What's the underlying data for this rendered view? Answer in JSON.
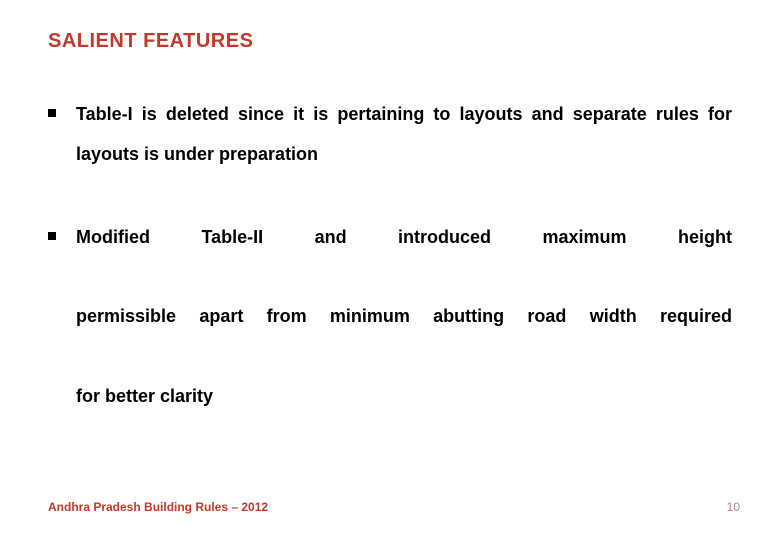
{
  "title": "SALIENT FEATURES",
  "bullets": [
    {
      "text": "Table-I is deleted since it is pertaining to layouts and separate rules for layouts is under preparation"
    },
    {
      "line1": "Modified Table-II and introduced maximum height",
      "line2": "permissible apart from minimum abutting road width required",
      "line3": "for better clarity"
    }
  ],
  "footer": "Andhra Pradesh Building Rules – 2012",
  "page_number": "10"
}
